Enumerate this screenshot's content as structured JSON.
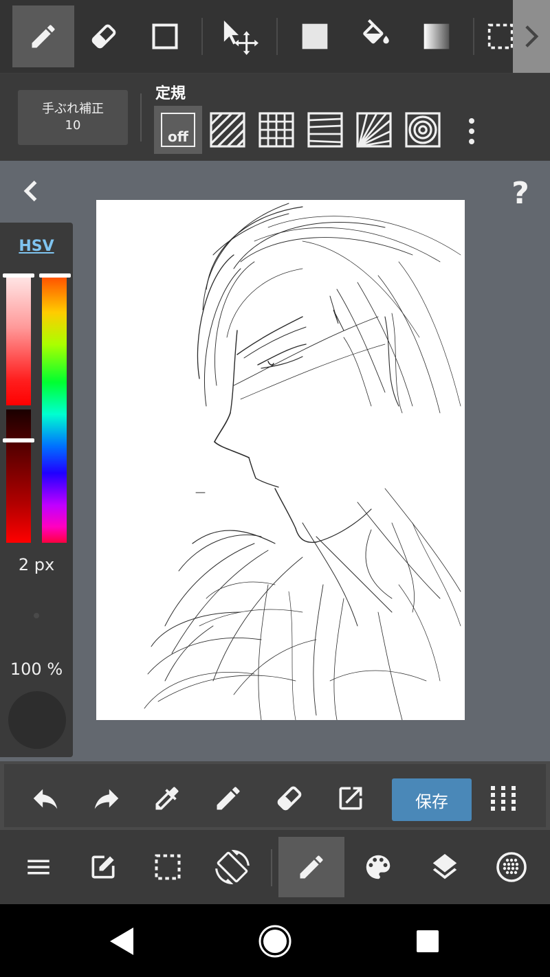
{
  "top_toolbar": {
    "tools": [
      {
        "name": "pen",
        "icon": "pen-icon",
        "active": true
      },
      {
        "name": "eraser",
        "icon": "eraser-icon",
        "active": false
      },
      {
        "name": "rectangle",
        "icon": "rectangle-icon",
        "active": false
      },
      {
        "name": "move",
        "icon": "move-icon",
        "active": false
      },
      {
        "name": "fill-color",
        "icon": "square-fill-icon",
        "active": false
      },
      {
        "name": "bucket",
        "icon": "paint-bucket-icon",
        "active": false
      },
      {
        "name": "gradient",
        "icon": "gradient-icon",
        "active": false
      },
      {
        "name": "select",
        "icon": "selection-icon",
        "active": false
      }
    ]
  },
  "stabilizer": {
    "label": "手ぶれ補正",
    "value": "10"
  },
  "ruler": {
    "title": "定規",
    "off_label": "off",
    "options": [
      "off",
      "parallel",
      "grid",
      "perspective",
      "radial",
      "concentric"
    ]
  },
  "color_panel": {
    "mode_label": "HSV",
    "brush_size": "2 px",
    "opacity": "100 %",
    "colors": {
      "hue_top": "#ff5a1a",
      "current": "#2d2d2d"
    }
  },
  "action_bar": {
    "save_label": "保存"
  },
  "menu_bar": {
    "items": [
      "menu",
      "edit",
      "selection",
      "rotate",
      "brush",
      "palette",
      "layers",
      "materials"
    ]
  },
  "colors": {
    "toolbar_bg": "#333333",
    "canvas_bg": "#63686f",
    "accent": "#4a88b8",
    "hsv_link": "#7fc4f0"
  }
}
